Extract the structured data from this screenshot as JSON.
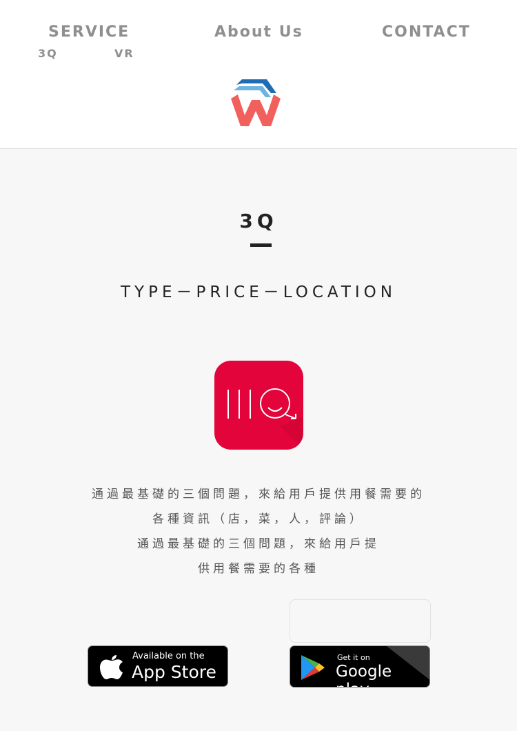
{
  "nav": {
    "service": "SERVICE",
    "about": "About Us",
    "contact": "CONTACT",
    "sub_3q": "3Q",
    "sub_vr": "VR"
  },
  "section": {
    "title": "3Q",
    "tagline": "TYPE－PRICE－LOCATION"
  },
  "description": {
    "line1": "通過最基礎的三個問題，來給用戶提供用餐需要的",
    "line2": "各種資訊（店，菜，人，評論）",
    "line3": "通過最基礎的三個問題，來給用戶提",
    "line4": "供用餐需要的各種"
  },
  "badges": {
    "appstore_small": "Available on the",
    "appstore_big": "App Store",
    "googleplay_small": "Get it on",
    "googleplay_big": "Google play"
  },
  "colors": {
    "app_icon": "#e3043b",
    "logo_blue": "#2f7fc1",
    "logo_coral": "#f2605e",
    "nav_gray": "#8f8f8f"
  }
}
